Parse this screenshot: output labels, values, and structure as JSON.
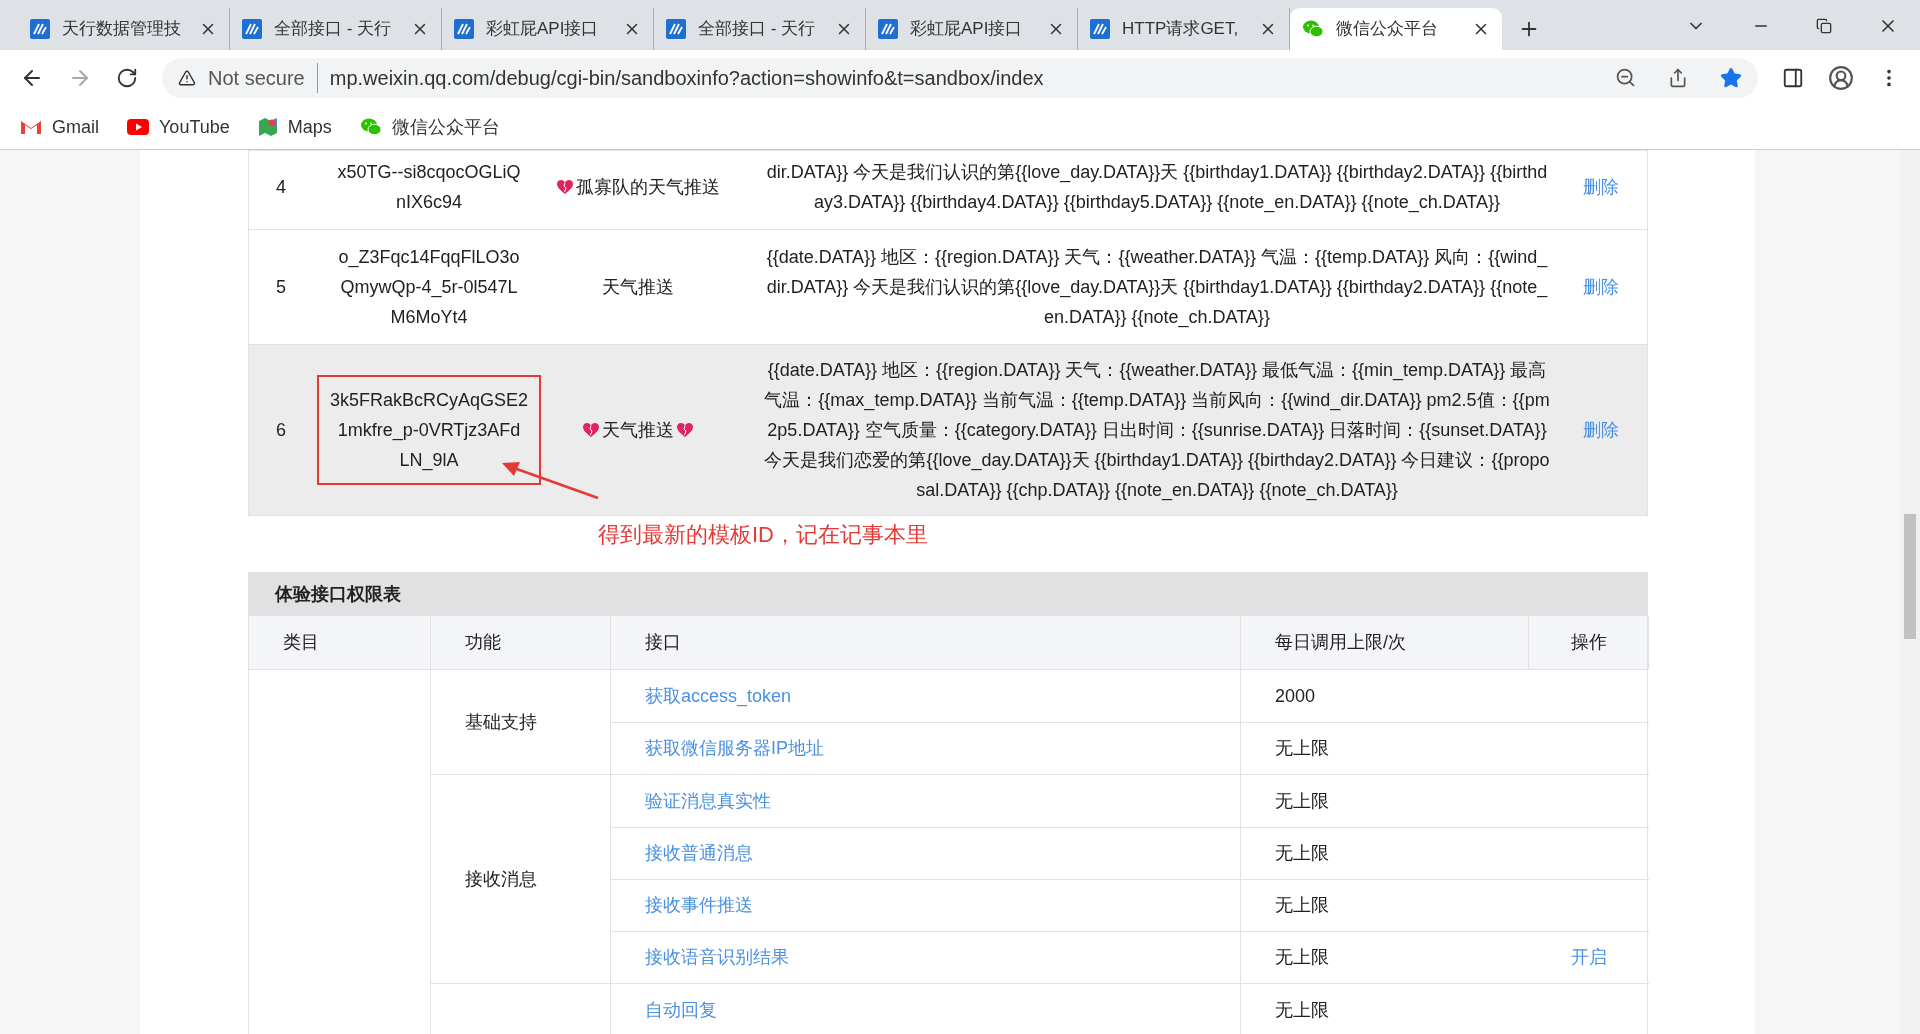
{
  "browser": {
    "tabs": [
      {
        "title": "天行数据管理技",
        "kind": "tx",
        "selected": false
      },
      {
        "title": "全部接口 - 天行",
        "kind": "tx",
        "selected": false
      },
      {
        "title": "彩虹屁API接口",
        "kind": "tx",
        "selected": false
      },
      {
        "title": "全部接口 - 天行",
        "kind": "tx",
        "selected": false
      },
      {
        "title": "彩虹屁API接口",
        "kind": "tx",
        "selected": false
      },
      {
        "title": "HTTP请求GET,",
        "kind": "tx",
        "selected": false
      },
      {
        "title": "微信公众平台",
        "kind": "wechat",
        "selected": true
      }
    ],
    "security": "Not secure",
    "url": "mp.weixin.qq.com/debug/cgi-bin/sandboxinfo?action=showinfo&t=sandbox/index",
    "bookmarked": true,
    "bookmarks": [
      {
        "label": "Gmail",
        "kind": "gmail"
      },
      {
        "label": "YouTube",
        "kind": "youtube"
      },
      {
        "label": "Maps",
        "kind": "maps"
      },
      {
        "label": "微信公众平台",
        "kind": "wechat"
      }
    ]
  },
  "templates": {
    "rows": [
      {
        "index": "4",
        "id": [
          "x50TG--si8cqocOGLiQ",
          "nIX6c94"
        ],
        "title": "孤寡队的天气推送",
        "heart_before": true,
        "heart_after": false,
        "content": [
          "dir.DATA}} 今天是我们认识的第{{love_day.DATA}}天 {{birthday1.DATA}} {{birthday2.DATA}} {{birthd",
          "ay3.DATA}} {{birthday4.DATA}} {{birthday5.DATA}} {{note_en.DATA}} {{note_ch.DATA}}"
        ],
        "action": "删除",
        "highlighted": false,
        "marked": false
      },
      {
        "index": "5",
        "id": [
          "o_Z3Fqc14FqqFlLO3o",
          "QmywQp-4_5r-0l547L",
          "M6MoYt4"
        ],
        "title": "天气推送",
        "heart_before": false,
        "heart_after": false,
        "content": [
          "{{date.DATA}} 地区：{{region.DATA}} 天气：{{weather.DATA}} 气温：{{temp.DATA}} 风向：{{wind_",
          "dir.DATA}} 今天是我们认识的第{{love_day.DATA}}天 {{birthday1.DATA}} {{birthday2.DATA}} {{note_",
          "en.DATA}} {{note_ch.DATA}}"
        ],
        "action": "删除",
        "highlighted": false,
        "marked": false
      },
      {
        "index": "6",
        "id": [
          "3k5FRakBcRCyAqGSE2",
          "1mkfre_p-0VRTjz3AFd",
          "LN_9lA"
        ],
        "title": "天气推送",
        "heart_before": true,
        "heart_after": true,
        "content": [
          "{{date.DATA}} 地区：{{region.DATA}} 天气：{{weather.DATA}} 最低气温：{{min_temp.DATA}} 最高",
          "气温：{{max_temp.DATA}} 当前气温：{{temp.DATA}} 当前风向：{{wind_dir.DATA}} pm2.5值：{{pm",
          "2p5.DATA}} 空气质量：{{category.DATA}} 日出时间：{{sunrise.DATA}} 日落时间：{{sunset.DATA}}",
          "今天是我们恋爱的第{{love_day.DATA}}天 {{birthday1.DATA}} {{birthday2.DATA}} 今日建议：{{propo",
          "sal.DATA}} {{chp.DATA}} {{note_en.DATA}} {{note_ch.DATA}}"
        ],
        "action": "删除",
        "highlighted": true,
        "marked": true
      }
    ],
    "annotation": "得到最新的模板ID，记在记事本里"
  },
  "permissions": {
    "title": "体验接口权限表",
    "columns": [
      "类目",
      "功能",
      "接口",
      "每日调用上限/次",
      "操作"
    ],
    "groups": [
      {
        "name": "基础支持",
        "apis": [
          {
            "name": "获取access_token",
            "limit": "2000"
          },
          {
            "name": "获取微信服务器IP地址",
            "limit": "无上限"
          }
        ]
      },
      {
        "name": "接收消息",
        "apis": [
          {
            "name": "验证消息真实性",
            "limit": "无上限"
          },
          {
            "name": "接收普通消息",
            "limit": "无上限"
          },
          {
            "name": "接收事件推送",
            "limit": "无上限"
          },
          {
            "name": "接收语音识别结果",
            "limit": "无上限",
            "action": "开启"
          }
        ]
      },
      {
        "apis": [
          {
            "name": "自动回复",
            "limit": "无上限"
          }
        ]
      }
    ]
  }
}
